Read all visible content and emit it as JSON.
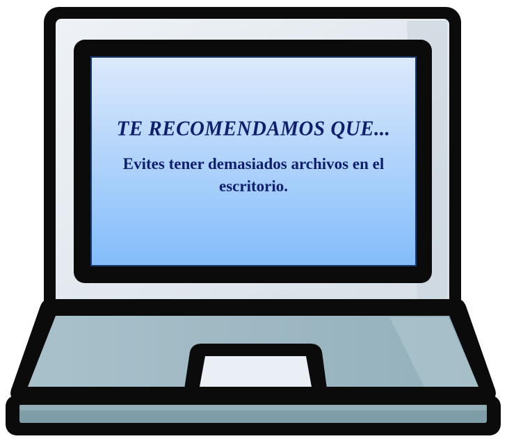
{
  "screen": {
    "headline": "TE RECOMENDAMOS QUE...",
    "message": "Evites tener demasiados archivos en el escritorio."
  },
  "colors": {
    "outline": "#0b0b0b",
    "bezel": "#dfe6ec",
    "screen_top": "#dce9fb",
    "screen_bottom": "#83bdfb",
    "text": "#0f1f6e",
    "keyboard": "#a4bcc6",
    "touchpad": "#e9eff4"
  },
  "icons": [
    "laptop-icon"
  ]
}
